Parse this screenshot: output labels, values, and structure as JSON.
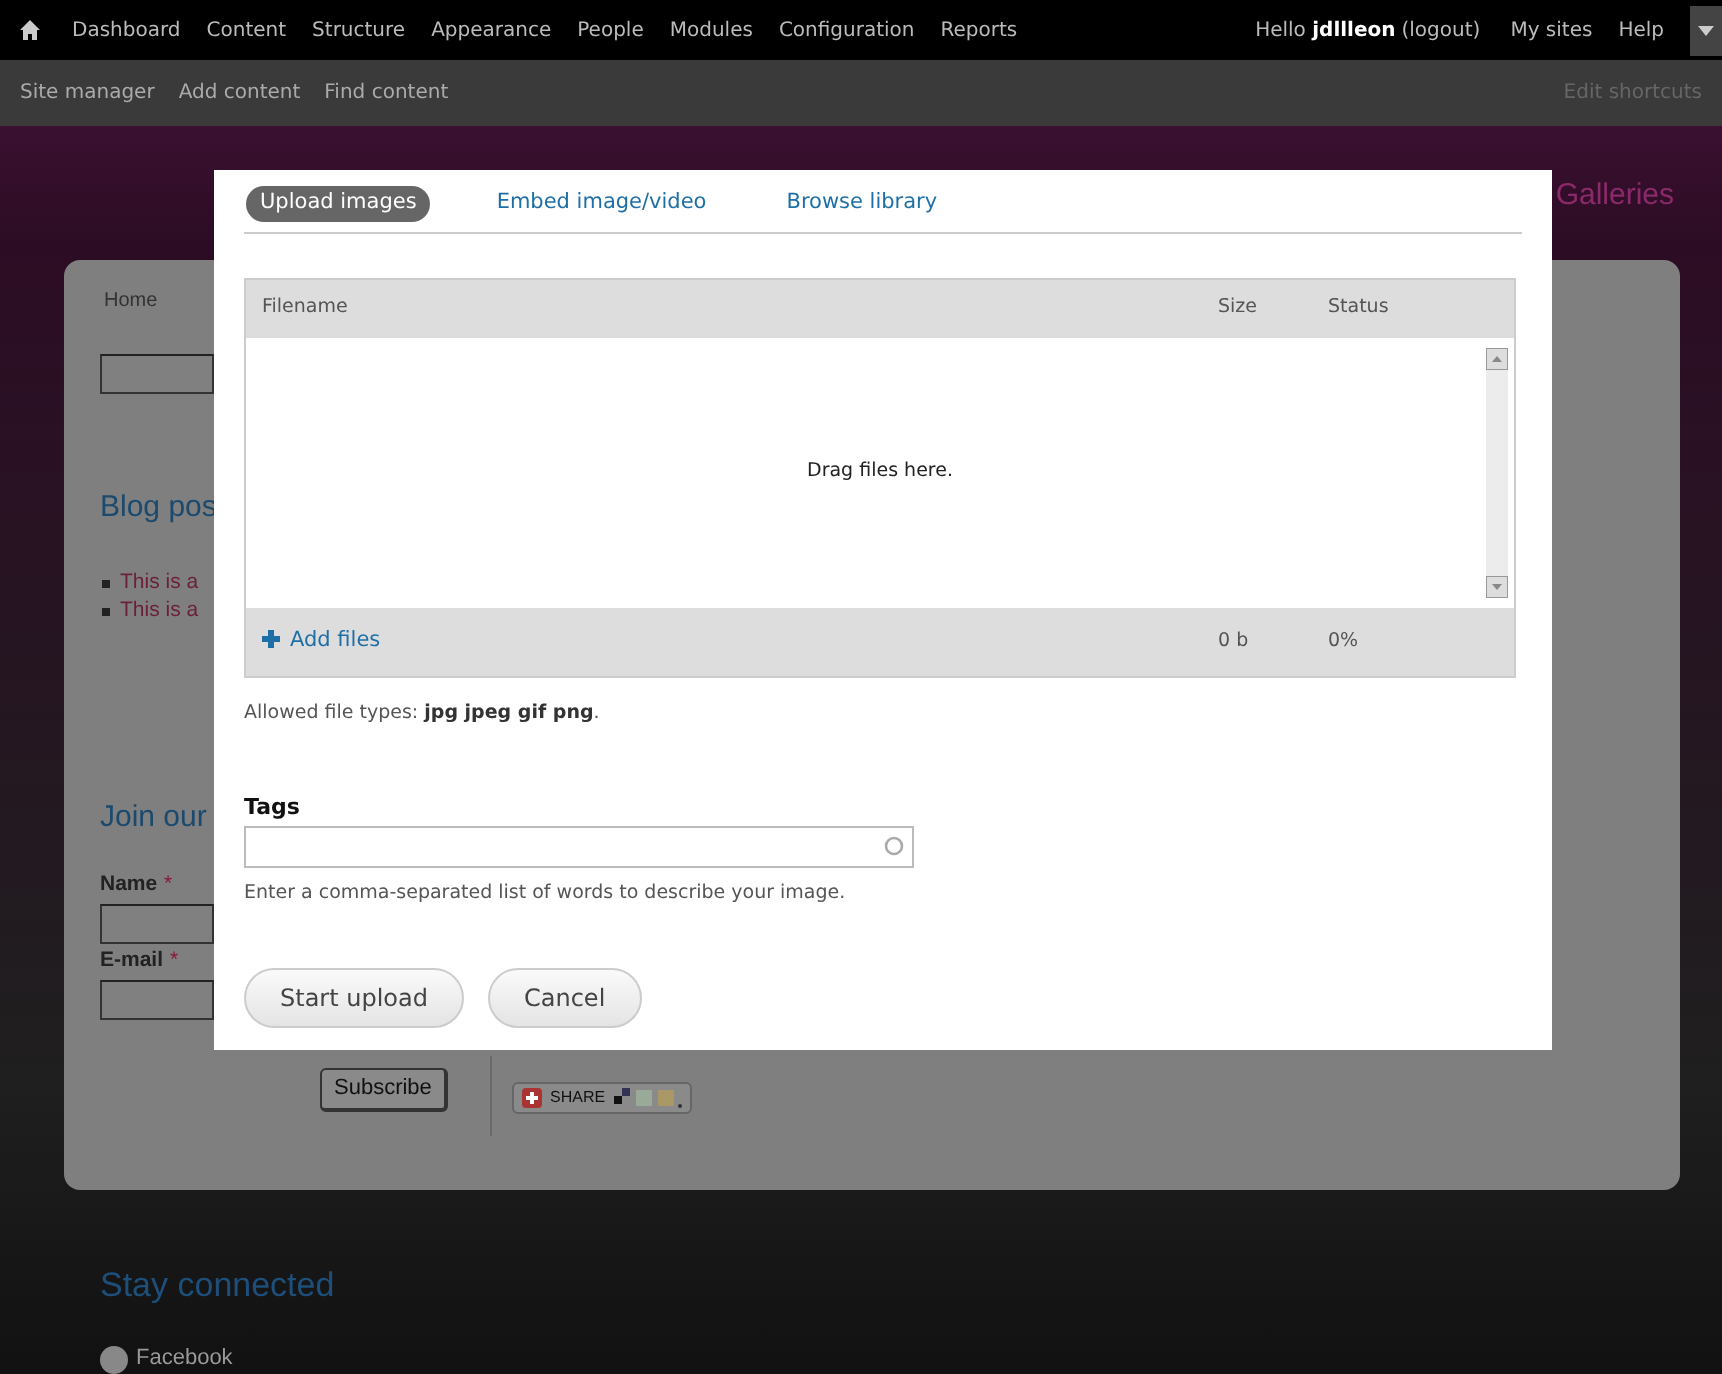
{
  "toolbar": {
    "menu": [
      "Dashboard",
      "Content",
      "Structure",
      "Appearance",
      "People",
      "Modules",
      "Configuration",
      "Reports"
    ],
    "greeting": "Hello **jdllleon**",
    "logout": "(logout)",
    "right_links": [
      "My sites",
      "Help"
    ]
  },
  "shortcuts": {
    "items": [
      "Site manager",
      "Add content",
      "Find content"
    ],
    "edit": "Edit shortcuts"
  },
  "background_page": {
    "side_heading": "Galleries",
    "breadcrumb": "Home",
    "blog_heading": "Blog pos",
    "blog_items": [
      "This is a",
      "This is a"
    ],
    "join_heading": "Join our",
    "fields": [
      {
        "label": "Name",
        "required_mark": "*"
      },
      {
        "label": "E-mail",
        "required_mark": "*"
      }
    ],
    "subscribe": "Subscribe",
    "share": "SHARE",
    "footer_heading": "Stay connected",
    "footer_link": "Facebook"
  },
  "dialog": {
    "tabs": [
      {
        "label": "Upload images",
        "selected": true
      },
      {
        "label": "Embed image/video",
        "selected": false
      },
      {
        "label": "Browse library",
        "selected": false
      }
    ],
    "uploader": {
      "columns": [
        "Filename",
        "Size",
        "Status"
      ],
      "drop_hint": "Drag files here.",
      "add_files": "Add files",
      "total_size": "0 b",
      "total_status": "0%"
    },
    "allowed_types": "Allowed file types: **jpg jpeg gif png**.",
    "tags": {
      "label": "Tags",
      "description": "Enter a comma-separated list of words to describe your image."
    },
    "buttons": [
      "Start upload",
      "Cancel"
    ]
  }
}
